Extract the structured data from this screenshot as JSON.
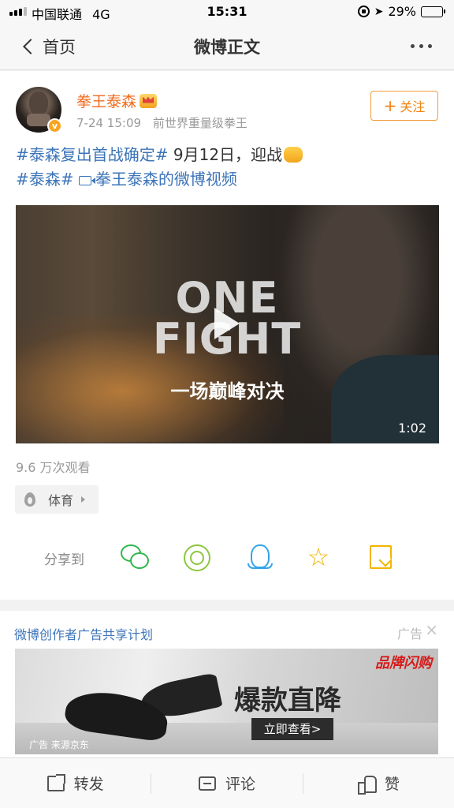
{
  "status_bar": {
    "carrier": "中国联通",
    "network": "4G",
    "time": "15:31",
    "battery": "29%",
    "battery_level": 0.29
  },
  "nav": {
    "back_label": "首页",
    "title": "微博正文"
  },
  "post": {
    "author": "拳王泰森",
    "time": "7-24 15:09",
    "bio": "前世界重量级拳王",
    "follow_label": "关注",
    "text": {
      "topic1": "#泰森复出首战确定#",
      "body": " 9月12日，迎战",
      "topic2": "#泰森#",
      "video_link": "拳王泰森的微博视频"
    },
    "video": {
      "title_line1": "ONE",
      "title_line2": "FIGHT",
      "subtitle": "一场巅峰对决",
      "duration": "1:02"
    },
    "views": "9.6 万次观看",
    "tag": "体育",
    "share_label": "分享到"
  },
  "ad": {
    "title": "微博创作者广告共享计划",
    "tag": "广告",
    "brand": "品牌闪购",
    "headline": "爆款直降",
    "cta": "立即查看>",
    "source": "广告 来源京东"
  },
  "actions": {
    "repost": "转发",
    "comment": "评论",
    "like": "赞"
  },
  "colors": {
    "accent_orange": "#f06b1d",
    "link_blue": "#3c74b8"
  }
}
